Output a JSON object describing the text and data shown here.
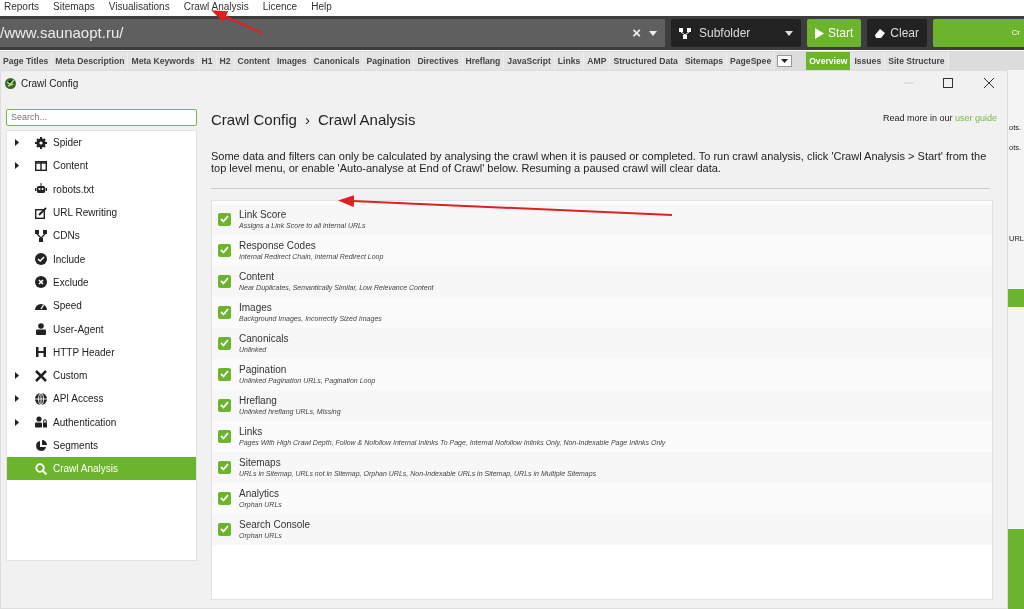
{
  "menu": [
    "Reports",
    "Sitemaps",
    "Visualisations",
    "Crawl Analysis",
    "Licence",
    "Help"
  ],
  "toolbar": {
    "url": "/www.saunaopt.ru/",
    "clear_symbol": "×",
    "mode": "Subfolder",
    "start": "Start",
    "clear": "Clear",
    "crawl_button": "Cr"
  },
  "tabs": [
    {
      "label": "Page Titles",
      "selected": false
    },
    {
      "label": "Meta Description",
      "selected": false
    },
    {
      "label": "Meta Keywords",
      "selected": false
    },
    {
      "label": "H1",
      "selected": false
    },
    {
      "label": "H2",
      "selected": false
    },
    {
      "label": "Content",
      "selected": false
    },
    {
      "label": "Images",
      "selected": false
    },
    {
      "label": "Canonicals",
      "selected": false
    },
    {
      "label": "Pagination",
      "selected": false
    },
    {
      "label": "Directives",
      "selected": false
    },
    {
      "label": "Hreflang",
      "selected": false
    },
    {
      "label": "JavaScript",
      "selected": false
    },
    {
      "label": "Links",
      "selected": false
    },
    {
      "label": "AMP",
      "selected": false
    },
    {
      "label": "Structured Data",
      "selected": false
    },
    {
      "label": "Sitemaps",
      "selected": false
    },
    {
      "label": "PageSpee",
      "selected": false
    }
  ],
  "right_tabs": [
    {
      "label": "Overview",
      "selected": true
    },
    {
      "label": "Issues",
      "selected": false
    },
    {
      "label": "Site Structure",
      "selected": false
    }
  ],
  "background_texts": [
    "ots.",
    "ots.",
    "URL"
  ],
  "dialog": {
    "title": "Crawl Config",
    "sidebar": {
      "search": {
        "placeholder": "Search..."
      },
      "items": [
        {
          "label": "Spider",
          "expandable": true,
          "selected": false
        },
        {
          "label": "Content",
          "expandable": true,
          "selected": false
        },
        {
          "label": "robots.txt",
          "expandable": false,
          "selected": false
        },
        {
          "label": "URL Rewriting",
          "expandable": false,
          "selected": false
        },
        {
          "label": "CDNs",
          "expandable": false,
          "selected": false
        },
        {
          "label": "Include",
          "expandable": false,
          "selected": false
        },
        {
          "label": "Exclude",
          "expandable": false,
          "selected": false
        },
        {
          "label": "Speed",
          "expandable": false,
          "selected": false
        },
        {
          "label": "User-Agent",
          "expandable": false,
          "selected": false
        },
        {
          "label": "HTTP Header",
          "expandable": false,
          "selected": false
        },
        {
          "label": "Custom",
          "expandable": true,
          "selected": false
        },
        {
          "label": "API Access",
          "expandable": true,
          "selected": false
        },
        {
          "label": "Authentication",
          "expandable": true,
          "selected": false
        },
        {
          "label": "Segments",
          "expandable": false,
          "selected": false
        },
        {
          "label": "Crawl Analysis",
          "expandable": false,
          "selected": true
        }
      ]
    },
    "breadcrumb": [
      "Crawl Config",
      "Crawl Analysis"
    ],
    "breadcrumb_separator": "›",
    "read_more": "Read more in our",
    "read_more_link": "user guide",
    "description": "Some data and filters can only be calculated by analysing the crawl when it is paused or completed. To run crawl analysis, click 'Crawl Analysis > Start' from the top level menu, or enable 'Auto-analyse at End of Crawl' below. Resuming a paused crawl will clear data.",
    "options": [
      {
        "title": "Link Score",
        "detail": "Assigns a Link Score to all internal URLs",
        "checked": true
      },
      {
        "title": "Response Codes",
        "detail": "Internal Redirect Chain, Internal Redirect Loop",
        "checked": true
      },
      {
        "title": "Content",
        "detail": "Near Duplicates, Semantically Similar, Low Relevance Content",
        "checked": true
      },
      {
        "title": "Images",
        "detail": "Background Images, Incorrectly Sized Images",
        "checked": true
      },
      {
        "title": "Canonicals",
        "detail": "Unlinked",
        "checked": true
      },
      {
        "title": "Pagination",
        "detail": "Unlinked Pagination URLs, Pagination Loop",
        "checked": true
      },
      {
        "title": "Hreflang",
        "detail": "Unlinked hreflang URLs, Missing",
        "checked": true
      },
      {
        "title": "Links",
        "detail": "Pages With High Crawl Depth, Follow & Nofollow Internal Inlinks To Page, Internal Nofollow Inlinks Only, Non-Indexable Page Inlinks Only",
        "checked": true
      },
      {
        "title": "Sitemaps",
        "detail": "URLs in Sitemap, URLs not in Sitemap, Orphan URLs, Non-Indexable URLs in Sitemap, URLs in Multiple Sitemaps",
        "checked": true
      },
      {
        "title": "Analytics",
        "detail": "Orphan URLs",
        "checked": true
      },
      {
        "title": "Search Console",
        "detail": "Orphan URLs",
        "checked": true
      }
    ]
  }
}
